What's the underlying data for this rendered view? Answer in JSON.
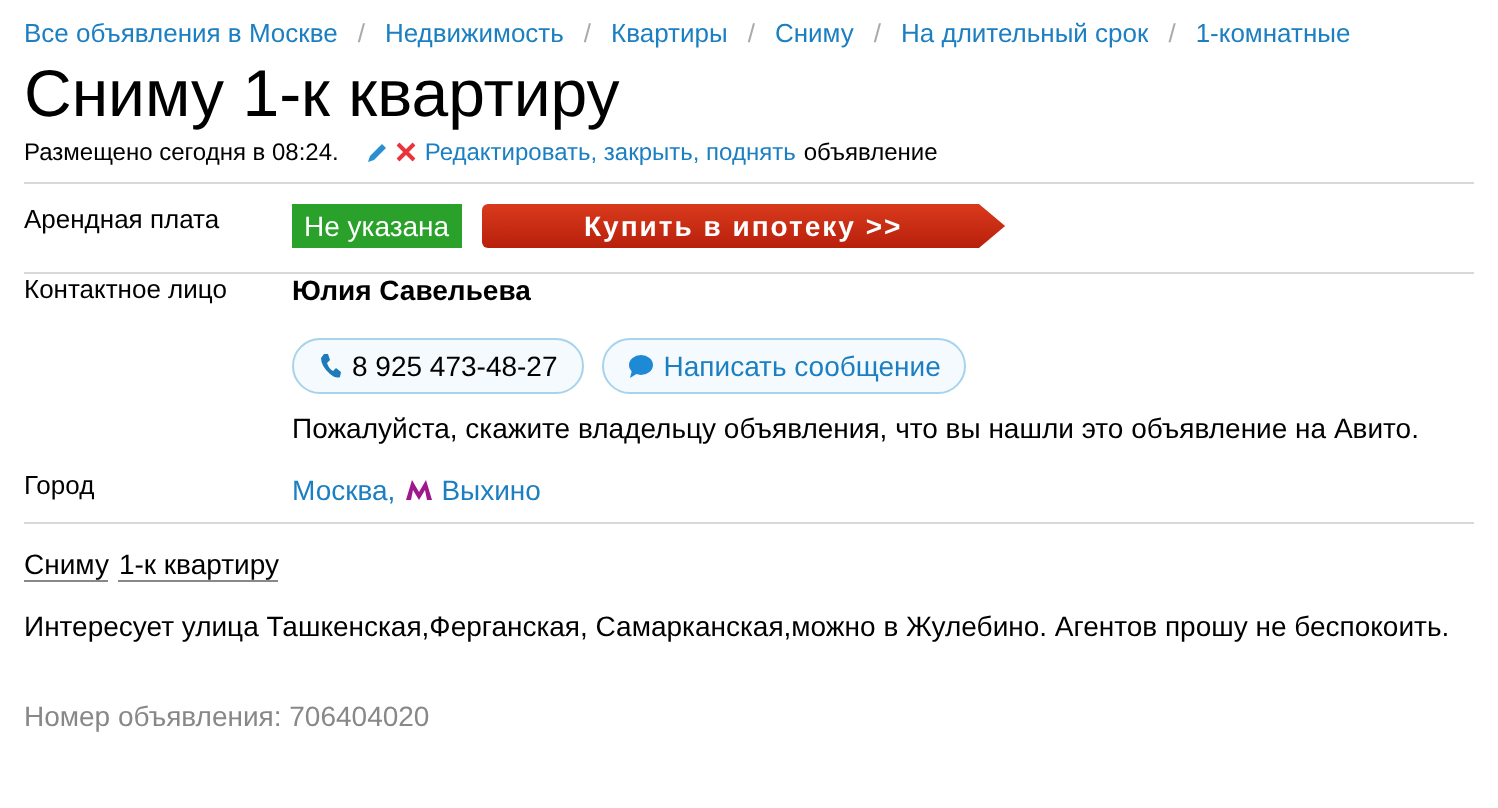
{
  "breadcrumbs": [
    "Все объявления в Москве",
    "Недвижимость",
    "Квартиры",
    "Сниму",
    "На длительный срок",
    "1-комнатные"
  ],
  "breadcrumb_separator": "/",
  "title": "Сниму 1-к квартиру",
  "meta": {
    "posted": "Размещено сегодня в 08:24.",
    "actions": "Редактировать, закрыть, поднять",
    "actions_suffix": "объявление"
  },
  "price": {
    "label": "Арендная плата",
    "value": "Не указана",
    "mortgage_button": "Купить в ипотеку >>"
  },
  "contact": {
    "label": "Контактное лицо",
    "name": "Юлия Савельева",
    "phone": "8 925 473-48-27",
    "message_button": "Написать сообщение",
    "note": "Пожалуйста, скажите владельцу объявления, что вы нашли это объявление на Авито."
  },
  "city": {
    "label": "Город",
    "city": "Москва,",
    "metro": "Выхино"
  },
  "description_links": [
    "Сниму",
    "1-к квартиру"
  ],
  "description": "Интересует улица Ташкенская,Ферганская, Самарканская,можно в Жулебино. Агентов прошу не беспокоить.",
  "ad_number": "Номер объявления: 706404020"
}
